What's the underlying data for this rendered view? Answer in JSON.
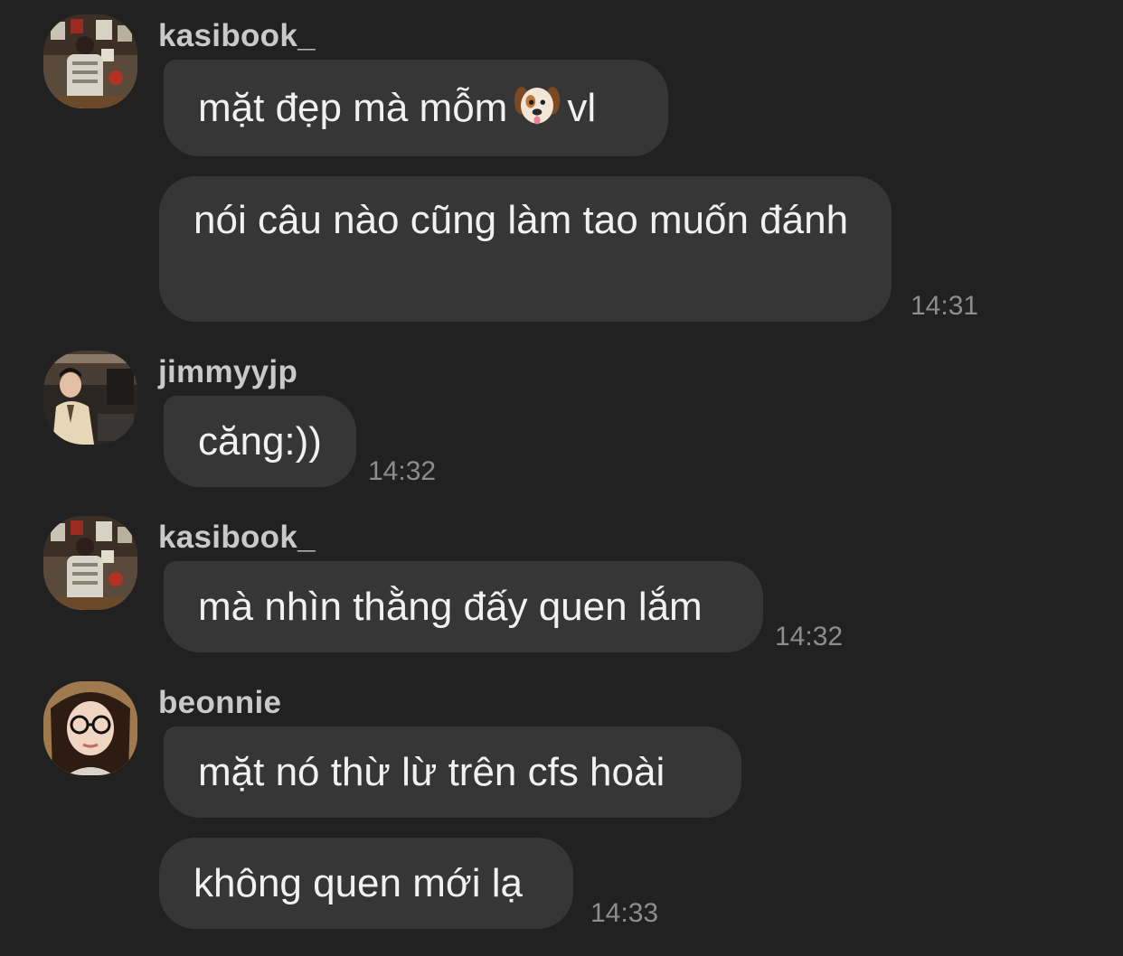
{
  "messages": [
    {
      "username": "kasibook_",
      "avatar": "avatar-kasibook",
      "bubbles": [
        "mặt đẹp mà mỗm",
        "vl",
        "nói câu nào cũng làm tao muốn đánh"
      ],
      "emoji": "dog-face-emoji",
      "time": "14:31"
    },
    {
      "username": "jimmyyjp",
      "avatar": "avatar-jimmyyjp",
      "bubbles": [
        "căng:))"
      ],
      "time": "14:32"
    },
    {
      "username": "kasibook_",
      "avatar": "avatar-kasibook",
      "bubbles": [
        "mà nhìn thằng đấy quen lắm"
      ],
      "time": "14:32"
    },
    {
      "username": "beonnie",
      "avatar": "avatar-beonnie",
      "bubbles": [
        "mặt nó thừ lừ trên cfs hoài",
        "không quen mới lạ"
      ],
      "time": "14:33"
    }
  ],
  "colors": {
    "background": "#212121",
    "bubble": "#363636",
    "username": "#c9c9c9",
    "message_text": "#f1f1f1",
    "timestamp": "#8d8d8d"
  }
}
